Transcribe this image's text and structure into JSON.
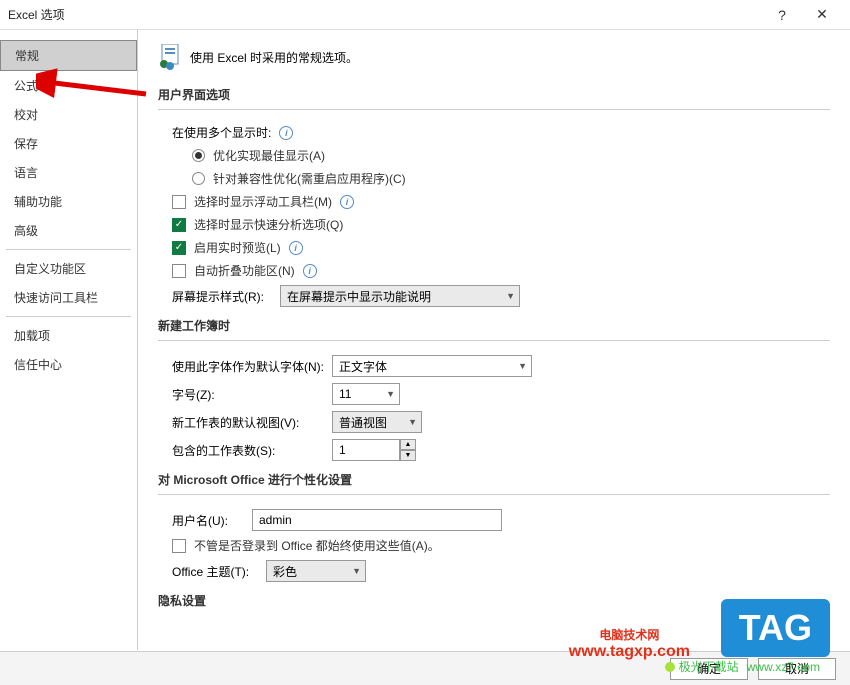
{
  "title": "Excel 选项",
  "sidebar": {
    "items": [
      {
        "label": "常规",
        "selected": true
      },
      {
        "label": "公式"
      },
      {
        "label": "校对"
      },
      {
        "label": "保存"
      },
      {
        "label": "语言"
      },
      {
        "label": "辅助功能"
      },
      {
        "label": "高级"
      },
      {
        "label": "_sep"
      },
      {
        "label": "自定义功能区"
      },
      {
        "label": "快速访问工具栏"
      },
      {
        "label": "_sep"
      },
      {
        "label": "加载项"
      },
      {
        "label": "信任中心"
      }
    ]
  },
  "header_text": "使用 Excel 时采用的常规选项。",
  "sections": {
    "ui": {
      "title": "用户界面选项",
      "multi_monitor_label": "在使用多个显示时:",
      "radio_optimize": "优化实现最佳显示(A)",
      "radio_compat": "针对兼容性优化(需重启应用程序)(C)",
      "chk_floating_toolbar": "选择时显示浮动工具栏(M)",
      "chk_quick_analysis": "选择时显示快速分析选项(Q)",
      "chk_live_preview": "启用实时预览(L)",
      "chk_auto_collapse": "自动折叠功能区(N)",
      "screentip_label": "屏幕提示样式(R):",
      "screentip_value": "在屏幕提示中显示功能说明"
    },
    "new_wb": {
      "title": "新建工作簿时",
      "font_label": "使用此字体作为默认字体(N):",
      "font_value": "正文字体",
      "size_label": "字号(Z):",
      "size_value": "11",
      "view_label": "新工作表的默认视图(V):",
      "view_value": "普通视图",
      "sheets_label": "包含的工作表数(S):",
      "sheets_value": "1"
    },
    "personal": {
      "title": "对 Microsoft Office 进行个性化设置",
      "username_label": "用户名(U):",
      "username_value": "admin",
      "always_use_label": "不管是否登录到 Office 都始终使用这些值(A)。",
      "theme_label": "Office 主题(T):",
      "theme_value": "彩色"
    },
    "privacy": {
      "title": "隐私设置"
    }
  },
  "footer": {
    "ok": "确定",
    "cancel": "取消"
  },
  "overlays": {
    "wm1_main": "电脑技术网",
    "wm1_sub": "www.tagxp.com",
    "tag": "TAG",
    "wm2": "极光下载站",
    "wm2_url": "www.xz7.com"
  }
}
